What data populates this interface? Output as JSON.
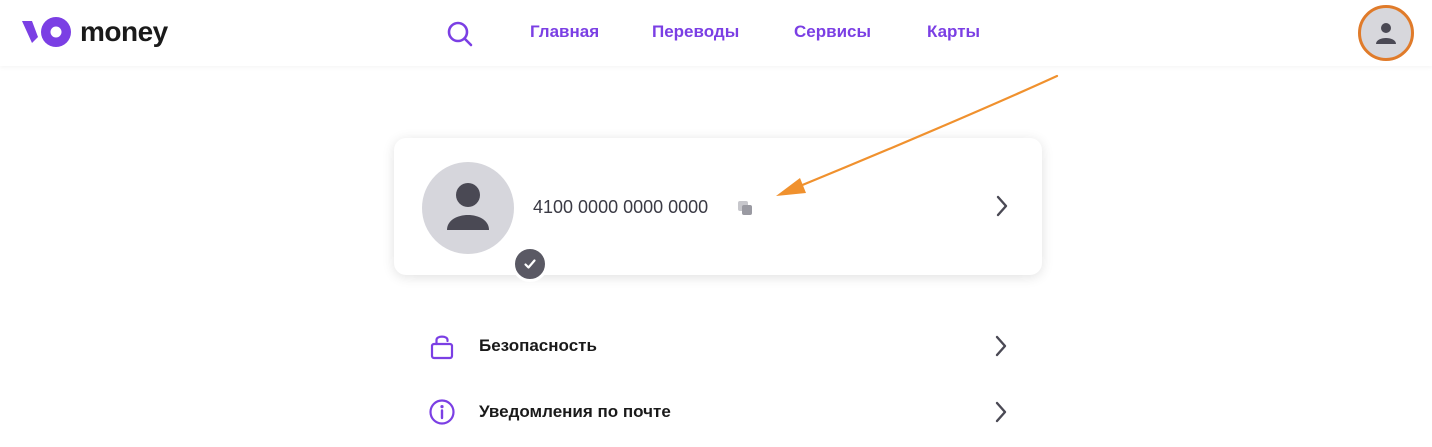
{
  "header": {
    "brand": "money",
    "nav": [
      "Главная",
      "Переводы",
      "Сервисы",
      "Карты"
    ],
    "accent_color": "#7b3fe4",
    "icons": {
      "search": "search-icon",
      "profile": "user-icon"
    }
  },
  "profile_card": {
    "wallet_number": "4100 0000 0000 0000",
    "icons": {
      "avatar": "user-icon",
      "badge": "check-icon",
      "copy": "copy-icon",
      "open": "chevron-right-icon"
    }
  },
  "menu": [
    {
      "label": "Безопасность",
      "icon": "lock-icon"
    },
    {
      "label": "Уведомления по почте",
      "icon": "info-icon"
    }
  ],
  "annotation": {
    "arrow_color": "#f0912e"
  }
}
